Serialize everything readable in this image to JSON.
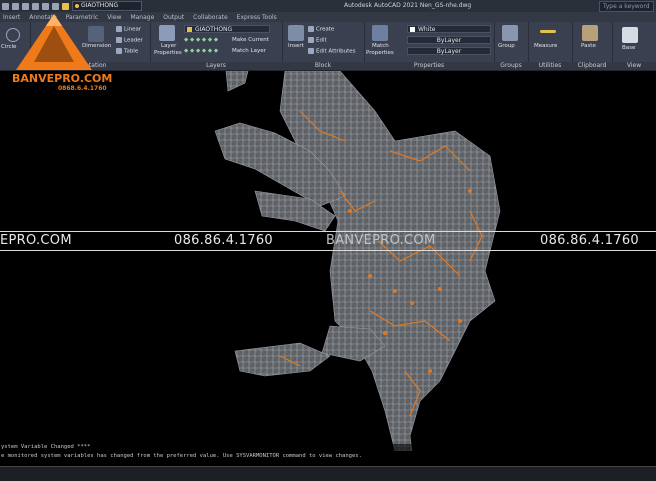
{
  "app": {
    "window_title": "Autodesk AutoCAD 2021   Nen_GS-nhe.dwg",
    "search_placeholder": "Type a keyword or"
  },
  "qat": {
    "layer_name": "GIAOTHONG"
  },
  "tabs": [
    "Insert",
    "Annotate",
    "Parametric",
    "View",
    "Manage",
    "Output",
    "Collaborate",
    "Express Tools"
  ],
  "ribbon": {
    "draw": {
      "circle": "Circle"
    },
    "annotation": {
      "dimension": "Dimension",
      "linear": "Linear",
      "leader": "Leader",
      "table": "Table",
      "label": "Annotation"
    },
    "layers": {
      "layer_properties_1": "Layer",
      "layer_properties_2": "Properties",
      "current_layer": "GIAOTHONG",
      "make_current": "Make Current",
      "match_layer": "Match Layer",
      "label": "Layers"
    },
    "block": {
      "insert": "Insert",
      "create": "Create",
      "edit": "Edit",
      "edit_attributes": "Edit Attributes",
      "label": "Block"
    },
    "properties": {
      "match_1": "Match",
      "match_2": "Properties",
      "color": "White",
      "linetype": "ByLayer",
      "lineweight": "ByLayer",
      "label": "Properties"
    },
    "groups": {
      "group": "Group",
      "label": "Groups"
    },
    "utilities": {
      "measure": "Measure",
      "label": "Utilities"
    },
    "clipboard": {
      "paste": "Paste",
      "label": "Clipboard"
    },
    "view": {
      "base": "Base",
      "label": "View"
    }
  },
  "watermark": {
    "brand": "BANVEPRO.COM",
    "phone": "0868.6.4.1760",
    "brand_left": "EPRO.COM",
    "band_phone": "086.86.4.1760",
    "band_brand": "BANVEPRO.COM"
  },
  "command_line": {
    "line1": "ystem Variable Changed ****",
    "line2": "e monitored system variables has changed from the preferred value. Use SYSVARMONITOR command to view changes."
  },
  "colors": {
    "ribbon_bg": "#3b4050",
    "accent_orange": "#f07a1a",
    "map_gray": "#8a8d92",
    "canvas": "#000000"
  }
}
